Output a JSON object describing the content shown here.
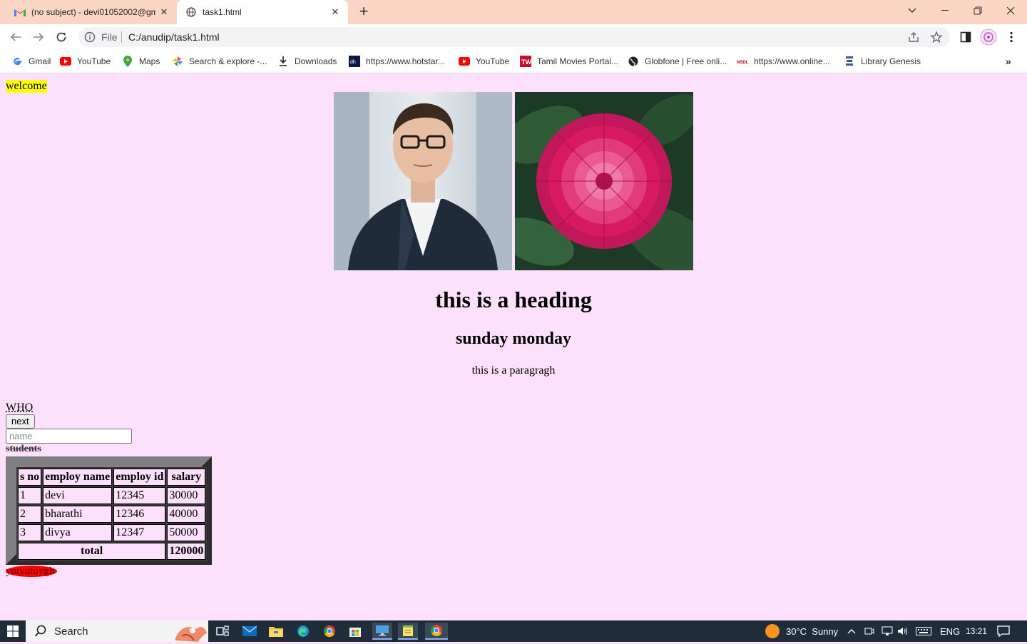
{
  "browser": {
    "tabs": [
      {
        "title": "(no subject) - devi01052002@gm",
        "icon": "gmail-icon",
        "active": false
      },
      {
        "title": "task1.html",
        "icon": "globe-icon",
        "active": true
      }
    ],
    "address": {
      "scheme": "File",
      "url": "C:/anudip/task1.html"
    },
    "bookmarks": [
      {
        "label": "Gmail",
        "icon": "google-icon"
      },
      {
        "label": "YouTube",
        "icon": "youtube-icon"
      },
      {
        "label": "Maps",
        "icon": "maps-icon"
      },
      {
        "label": "Search & explore -...",
        "icon": "pinwheel-icon"
      },
      {
        "label": "Downloads",
        "icon": "download-icon"
      },
      {
        "label": "https://www.hotstar...",
        "icon": "hotstar-icon"
      },
      {
        "label": "YouTube",
        "icon": "youtube-icon"
      },
      {
        "label": "Tamil Movies Portal...",
        "icon": "tamil-icon"
      },
      {
        "label": "Globfone | Free onli...",
        "icon": "globe-dark-icon"
      },
      {
        "label": "https://www.online...",
        "icon": "nsdl-icon"
      },
      {
        "label": "Library Genesis",
        "icon": "library-icon"
      }
    ]
  },
  "page": {
    "welcome": "welcome",
    "heading": "this is a heading",
    "subheading": "sunday monday",
    "paragraph": "this is a paragragh",
    "who": "WHO",
    "next_button": "next",
    "name_placeholder": "name",
    "students": "students",
    "table": {
      "headers": [
        "s no",
        "employ name",
        "employ id",
        "salary"
      ],
      "rows": [
        [
          "1",
          "devi",
          "12345",
          "30000"
        ],
        [
          "2",
          "bharathi",
          "12346",
          "40000"
        ],
        [
          "3",
          "divya",
          "12347",
          "50000"
        ]
      ],
      "total_label": "total",
      "total_value": "120000"
    },
    "oval_text": "yutyutuygh"
  },
  "taskbar": {
    "search_label": "Search",
    "weather": "30°C  Sunny",
    "language": "ENG",
    "time": "13:21"
  },
  "colors": {
    "page_bg": "#fde1fc",
    "welcome_highlight": "#ffff00",
    "oval": "#ff0000",
    "tab_strip": "#fbd6c4"
  }
}
